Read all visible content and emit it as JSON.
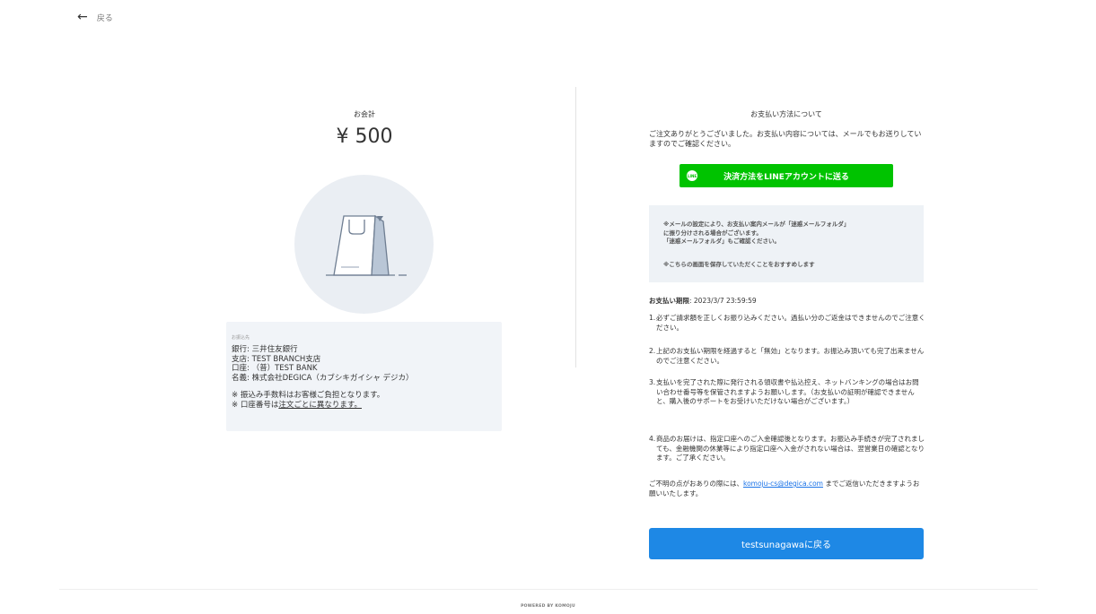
{
  "nav": {
    "back_label": "戻る"
  },
  "summary": {
    "total_label": "お会計",
    "amount": "¥ 500"
  },
  "bank_transfer": {
    "label": "お振込先",
    "bank": "銀行: 三井住友銀行",
    "branch": "支店: TEST BRANCH支店",
    "account": "口座: （普）TEST BANK",
    "holder": "名義: 株式会社DEGICA（カブシキガイシャ デジカ）",
    "note_fee": "※ 振込み手数料はお客様ご負担となります。",
    "note_account_prefix": "※ 口座番号は",
    "note_account_underlined": "注文ごとに異なります。"
  },
  "payment_info": {
    "heading": "お支払い方法について",
    "thanks": "ご注文ありがとうございました。お支払い内容については、メールでもお送りしていますのでご確認ください。",
    "line_button_label": "決済方法をLINEアカウントに送る",
    "line_icon_text": "LINE",
    "notice_line1": "※メールの設定により、お支払い案内メールが「迷惑メールフォルダ」",
    "notice_line2": "に振り分けされる場合がございます。",
    "notice_line3": "「迷惑メールフォルダ」もご確認ください。",
    "notice_tip": "※こちらの画面を保存していただくことをおすすめします",
    "deadline_label": "お支払い期限",
    "deadline_value": ": 2023/3/7 23:59:59",
    "notes": [
      {
        "num": "1.",
        "text": "必ずご請求額を正しくお振り込みください。過払い分のご返金はできませんのでご注意ください。"
      },
      {
        "num": "2.",
        "text": "上記のお支払い期限を経過すると「無効」となります。お振込み頂いても完了出来ませんのでご注意ください。"
      },
      {
        "num": "3.",
        "text": "支払いを完了された際に発行される領収書や払込控え、ネットバンキングの場合はお問い合わせ番号等を保管されますようお願いします。（お支払いの証明が確認できませんと、購入後のサポートをお受けいただけない場合がございます。）"
      },
      {
        "num": "4.",
        "text": "商品のお届けは、指定口座へのご入金確認後となります。お振込み手続きが完了されましても、金融機関の休業等により指定口座へ入金がされない場合は、翌営業日の確認となります。ご了承ください。"
      }
    ],
    "contact_prefix": "ご不明の点がおありの際には、",
    "contact_email": "komoju-cs@degica.com",
    "contact_suffix": " までご返信いただきますようお願いいたします。",
    "return_button_label": "testsunagawaに戻る"
  },
  "footer": {
    "powered_by": "POWERED BY KOMOJU"
  },
  "colors": {
    "line_green": "#00c300",
    "primary_blue": "#1e88e5",
    "link_blue": "#1a73e8"
  },
  "icons": {
    "back": "arrow-left-icon",
    "bag": "shopping-bag-icon",
    "line": "line-logo-icon"
  }
}
